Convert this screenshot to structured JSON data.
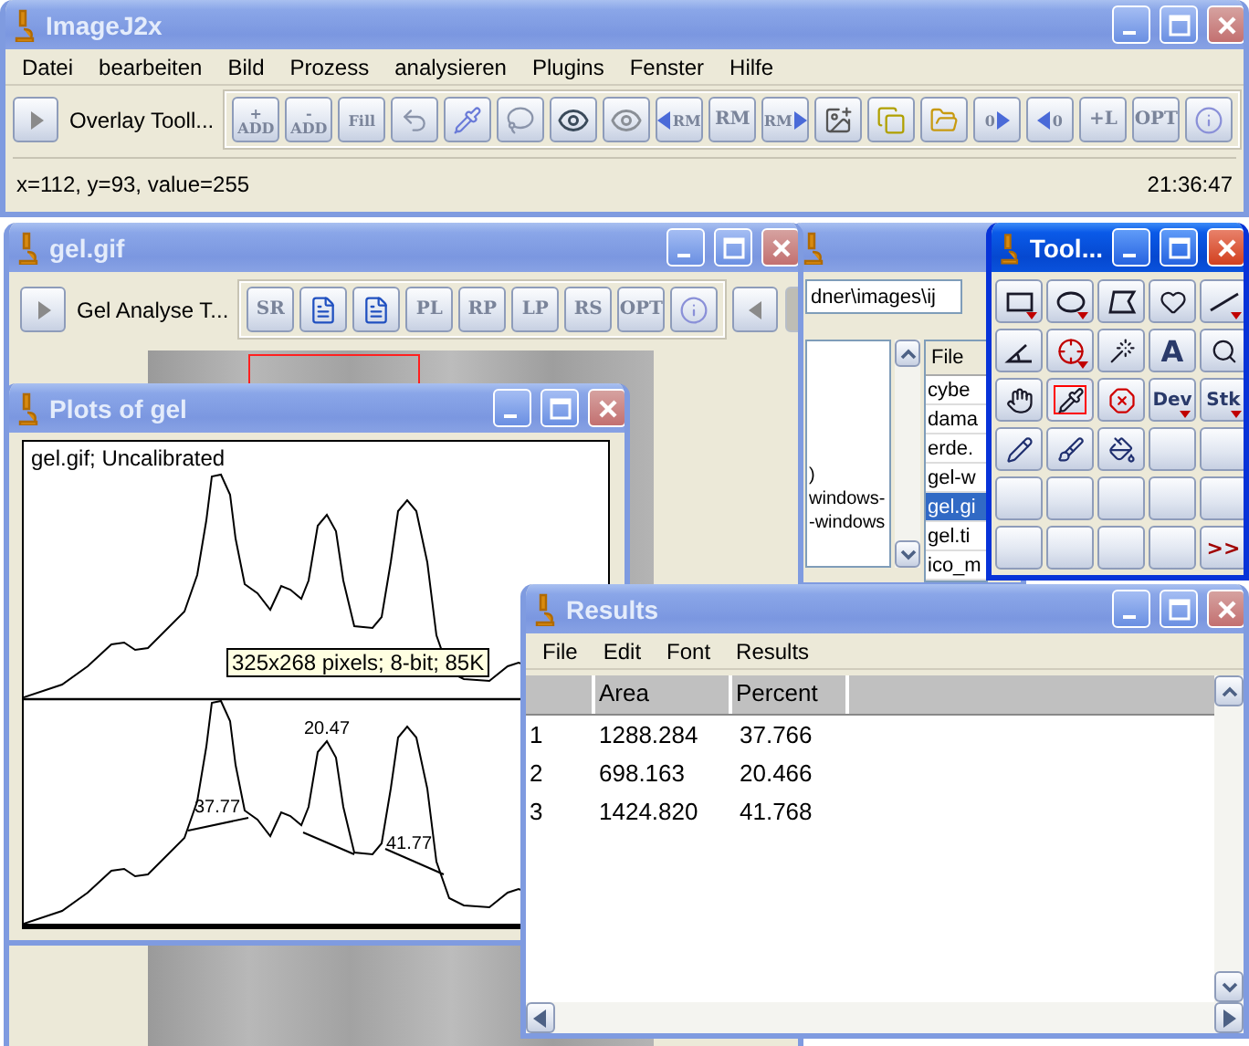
{
  "main_window": {
    "title": "ImageJ2x",
    "active": false,
    "menu": [
      "Datei",
      "bearbeiten",
      "Bild",
      "Prozess",
      "analysieren",
      "Plugins",
      "Fenster",
      "Hilfe"
    ],
    "toolbar": {
      "name": "Overlay Tooll...",
      "buttons": [
        {
          "kind": "text",
          "label": "+\nADD"
        },
        {
          "kind": "text",
          "label": "-\nADD"
        },
        {
          "kind": "text",
          "label": "Fill"
        },
        {
          "kind": "undo"
        },
        {
          "kind": "pipette"
        },
        {
          "kind": "lasso"
        },
        {
          "kind": "eye"
        },
        {
          "kind": "eye-dim"
        },
        {
          "kind": "arrow-left-text",
          "label": "RM"
        },
        {
          "kind": "text",
          "label": "RM"
        },
        {
          "kind": "arrow-right-text",
          "label": "RM"
        },
        {
          "kind": "image-add"
        },
        {
          "kind": "copy"
        },
        {
          "kind": "folder"
        },
        {
          "kind": "arrow-right-text",
          "label": "0"
        },
        {
          "kind": "arrow-left-text",
          "label": "0"
        },
        {
          "kind": "text",
          "label": "+L"
        },
        {
          "kind": "text",
          "label": "OPT"
        },
        {
          "kind": "info"
        }
      ]
    },
    "status": {
      "text": "x=112, y=93, value=255",
      "time": "21:36:47"
    }
  },
  "file_browser": {
    "active": false,
    "path": "dner\\images\\ij",
    "folders": [
      ")",
      "windows-",
      "-windows"
    ],
    "files_header": "File",
    "files": [
      {
        "name": "cybe",
        "selected": false
      },
      {
        "name": "dama",
        "selected": false
      },
      {
        "name": "erde.",
        "selected": false
      },
      {
        "name": "gel-w",
        "selected": false
      },
      {
        "name": "gel.gi",
        "selected": true
      },
      {
        "name": "gel.ti",
        "selected": false
      },
      {
        "name": "ico_m",
        "selected": false
      }
    ]
  },
  "gel_window": {
    "title": "gel.gif",
    "active": false,
    "toolbar": {
      "name": "Gel Analyse T...",
      "buttons": [
        {
          "kind": "text",
          "label": "SR"
        },
        {
          "kind": "document"
        },
        {
          "kind": "document"
        },
        {
          "kind": "text",
          "label": "PL"
        },
        {
          "kind": "text",
          "label": "RP"
        },
        {
          "kind": "text",
          "label": "LP"
        },
        {
          "kind": "text",
          "label": "RS"
        },
        {
          "kind": "text",
          "label": "OPT"
        },
        {
          "kind": "info"
        }
      ]
    }
  },
  "plot_window": {
    "title": "Plots of gel",
    "active": false,
    "caption": "gel.gif; Uncalibrated",
    "tooltip": "325x268 pixels; 8-bit; 85K",
    "peak_labels": [
      "37.77",
      "20.47",
      "41.77"
    ]
  },
  "tools_window": {
    "title": "Tool...",
    "active": true,
    "tools": [
      {
        "kind": "rectangle",
        "menu": true,
        "selected": false
      },
      {
        "kind": "oval",
        "menu": true,
        "selected": false
      },
      {
        "kind": "polygon",
        "menu": false,
        "selected": false
      },
      {
        "kind": "freehand",
        "menu": false,
        "selected": false
      },
      {
        "kind": "line",
        "menu": true,
        "selected": false
      },
      {
        "kind": "angle",
        "menu": false,
        "selected": false
      },
      {
        "kind": "point",
        "menu": true,
        "selected": false
      },
      {
        "kind": "wand",
        "menu": false,
        "selected": false
      },
      {
        "kind": "text",
        "label": "A",
        "menu": false,
        "selected": false
      },
      {
        "kind": "magnifier",
        "menu": false,
        "selected": false
      },
      {
        "kind": "hand",
        "menu": false,
        "selected": false
      },
      {
        "kind": "dropper",
        "menu": false,
        "selected": true
      },
      {
        "kind": "x-octagon",
        "menu": false,
        "selected": false
      },
      {
        "kind": "text",
        "label": "Dev",
        "menu": true,
        "selected": false
      },
      {
        "kind": "text",
        "label": "Stk",
        "menu": true,
        "selected": false
      },
      {
        "kind": "pencil",
        "menu": false,
        "selected": false
      },
      {
        "kind": "brush",
        "menu": false,
        "selected": false
      },
      {
        "kind": "bucket",
        "menu": false,
        "selected": false
      },
      {
        "kind": "empty",
        "menu": false,
        "selected": false
      },
      {
        "kind": "empty",
        "menu": false,
        "selected": false
      },
      {
        "kind": "empty",
        "menu": false,
        "selected": false
      },
      {
        "kind": "empty",
        "menu": false,
        "selected": false
      },
      {
        "kind": "empty",
        "menu": false,
        "selected": false
      },
      {
        "kind": "empty",
        "menu": false,
        "selected": false
      },
      {
        "kind": "empty",
        "menu": false,
        "selected": false
      },
      {
        "kind": "empty",
        "menu": false,
        "selected": false
      },
      {
        "kind": "empty",
        "menu": false,
        "selected": false
      },
      {
        "kind": "empty",
        "menu": false,
        "selected": false
      },
      {
        "kind": "empty",
        "menu": false,
        "selected": false
      },
      {
        "kind": "more",
        "label": ">>",
        "menu": false,
        "selected": false
      }
    ]
  },
  "results_window": {
    "title": "Results",
    "active": false,
    "menu": [
      "File",
      "Edit",
      "Font",
      "Results"
    ],
    "columns": [
      "",
      "Area",
      "Percent"
    ],
    "rows": [
      [
        "1",
        "1288.284",
        "37.766"
      ],
      [
        "2",
        "698.163",
        "20.466"
      ],
      [
        "3",
        "1424.820",
        "41.768"
      ]
    ]
  }
}
